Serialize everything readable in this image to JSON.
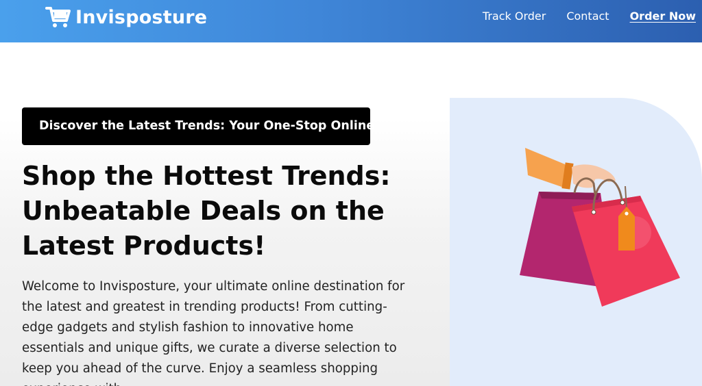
{
  "header": {
    "brand": "Invisposture",
    "logo_icon": "shopping-cart-icon",
    "nav": [
      {
        "label": "Track Order"
      },
      {
        "label": "Contact"
      },
      {
        "label": "Order Now"
      }
    ]
  },
  "hero": {
    "tagline": "Discover the Latest Trends: Your One-Stop Online",
    "headline": "Shop the Hottest Trends: Unbeatable Deals on the Latest Products!",
    "intro": "Welcome to Invisposture, your ultimate online destination for the latest and greatest in trending products! From cutting-edge gadgets and stylish fashion to innovative home essentials and unique gifts, we curate a diverse selection to keep you ahead of the curve. Enjoy a seamless shopping experience with",
    "illustration": "hand-holding-shopping-bags-illustration"
  },
  "colors": {
    "header_start": "#4aa0ec",
    "header_end": "#2c5fb0",
    "tagline_bg": "#000000",
    "panel_bg": "#e2ecfb",
    "bag_front": "#f03a5a",
    "bag_back": "#b3266e",
    "tag": "#f08a1c"
  }
}
